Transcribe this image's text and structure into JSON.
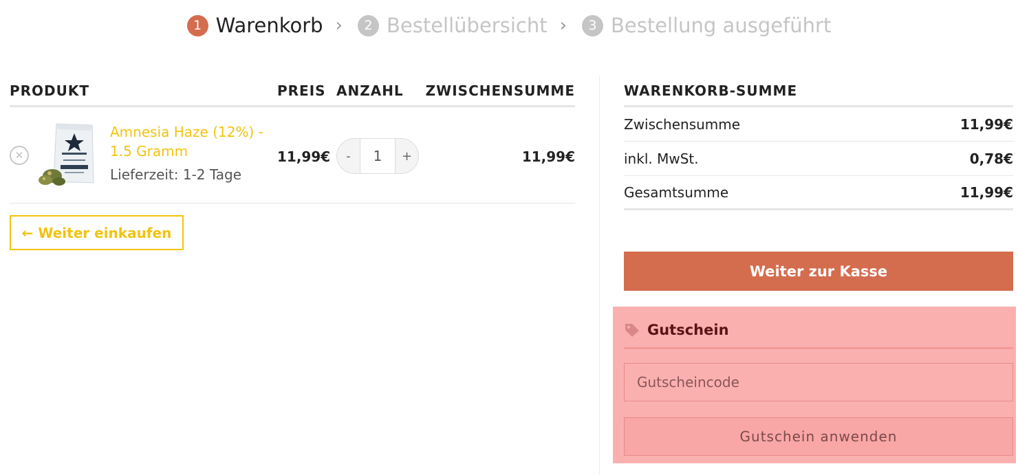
{
  "steps": [
    {
      "num": "1",
      "label": "Warenkorb",
      "active": true
    },
    {
      "num": "2",
      "label": "Bestellübersicht",
      "active": false
    },
    {
      "num": "3",
      "label": "Bestellung ausgeführt",
      "active": false
    }
  ],
  "cart": {
    "headers": {
      "product": "PRODUKT",
      "price": "PREIS",
      "quantity": "ANZAHL",
      "subtotal": "ZWISCHENSUMME"
    },
    "items": [
      {
        "name": "Amnesia Haze (12%) - 1.5 Gramm",
        "delivery": "Lieferzeit: 1-2 Tage",
        "price": "11,99€",
        "quantity": "1",
        "subtotal": "11,99€",
        "remove_icon": "close-circle-icon"
      }
    ],
    "qty_minus": "-",
    "qty_plus": "+",
    "continue_label": "← Weiter einkaufen"
  },
  "totals": {
    "title": "WARENKORB-SUMME",
    "rows": [
      {
        "label": "Zwischensumme",
        "value": "11,99€"
      },
      {
        "label": "inkl. MwSt.",
        "value": "0,78€"
      },
      {
        "label": "Gesamtsumme",
        "value": "11,99€"
      }
    ],
    "checkout_label": "Weiter zur Kasse"
  },
  "coupon": {
    "title": "Gutschein",
    "icon": "tag-icon",
    "placeholder": "Gutscheincode",
    "apply_label": "Gutschein anwenden",
    "highlight_color": "#fbb0b0"
  },
  "colors": {
    "accent": "#d46c4e",
    "link": "#f2c30f"
  }
}
